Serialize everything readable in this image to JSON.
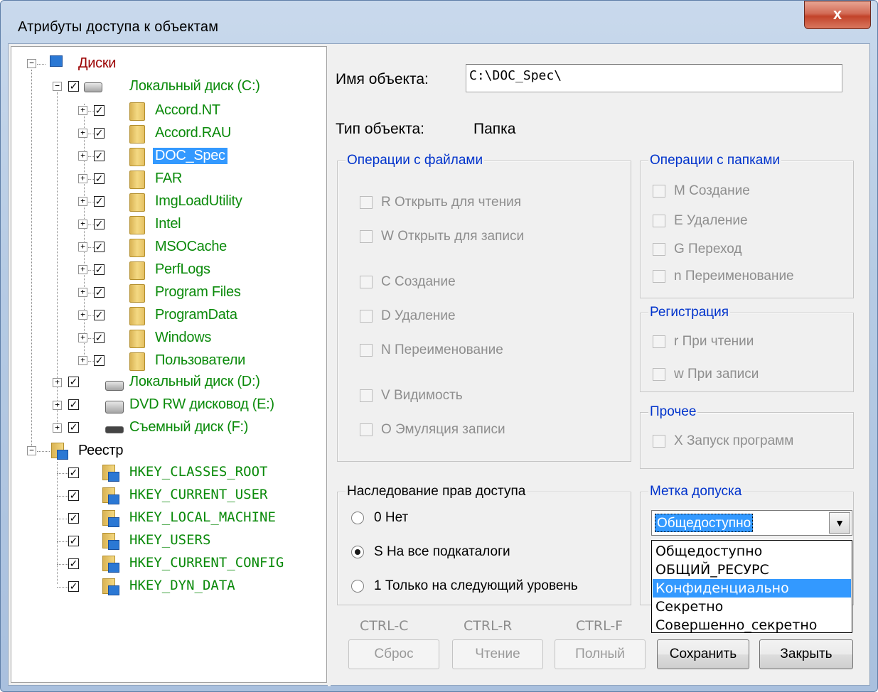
{
  "window": {
    "title": "Атрибуты доступа к объектам",
    "close_glyph": "x"
  },
  "tree": {
    "disks_label": "Диски",
    "drive_c": "Локальный диск (C:)",
    "folders": [
      "Accord.NT",
      "Accord.RAU",
      "DOC_Spec",
      "FAR",
      "ImgLoadUtility",
      "Intel",
      "MSOCache",
      "PerfLogs",
      "Program Files",
      "ProgramData",
      "Windows",
      "Пользователи"
    ],
    "selected_folder": "DOC_Spec",
    "drive_d": "Локальный диск (D:)",
    "drive_e": "DVD RW дисковод (E:)",
    "drive_f": "Съемный диск (F:)",
    "registry_label": "Реестр",
    "registry_keys": [
      "HKEY_CLASSES_ROOT",
      "HKEY_CURRENT_USER",
      "HKEY_LOCAL_MACHINE",
      "HKEY_USERS",
      "HKEY_CURRENT_CONFIG",
      "HKEY_DYN_DATA"
    ]
  },
  "object": {
    "name_label": "Имя объекта:",
    "name_value": "C:\\DOC_Spec\\",
    "type_label": "Тип объекта:",
    "type_value": "Папка"
  },
  "file_ops": {
    "title": "Операции с файлами",
    "items": [
      "R Открыть для чтения",
      "W Открыть для записи",
      "C Создание",
      "D Удаление",
      "N Переименование",
      "V Видимость",
      "O Эмуляция записи"
    ]
  },
  "folder_ops": {
    "title": "Операции с папками",
    "items": [
      "M Создание",
      "E Удаление",
      "G Переход",
      "n Переименование"
    ]
  },
  "registration": {
    "title": "Регистрация",
    "items": [
      "r При чтении",
      "w При записи"
    ]
  },
  "other": {
    "title": "Прочее",
    "items": [
      "X Запуск программ"
    ]
  },
  "inheritance": {
    "title": "Наследование прав доступа",
    "options": [
      "0 Нет",
      "S На все подкаталоги",
      "1 Только на следующий уровень"
    ],
    "selected_index": 1
  },
  "label": {
    "title": "Метка допуска",
    "selected": "Общедоступно",
    "options": [
      "Общедоступно",
      "ОБЩИЙ_РЕСУРС",
      "Конфиденциально",
      "Секретно",
      "Совершенно_секретно"
    ],
    "highlighted": "Конфиденциально"
  },
  "hotkeys": [
    "CTRL-C",
    "CTRL-R",
    "CTRL-F"
  ],
  "buttons": {
    "reset": "Сброс",
    "read": "Чтение",
    "full": "Полный",
    "save": "Сохранить",
    "close": "Закрыть"
  }
}
